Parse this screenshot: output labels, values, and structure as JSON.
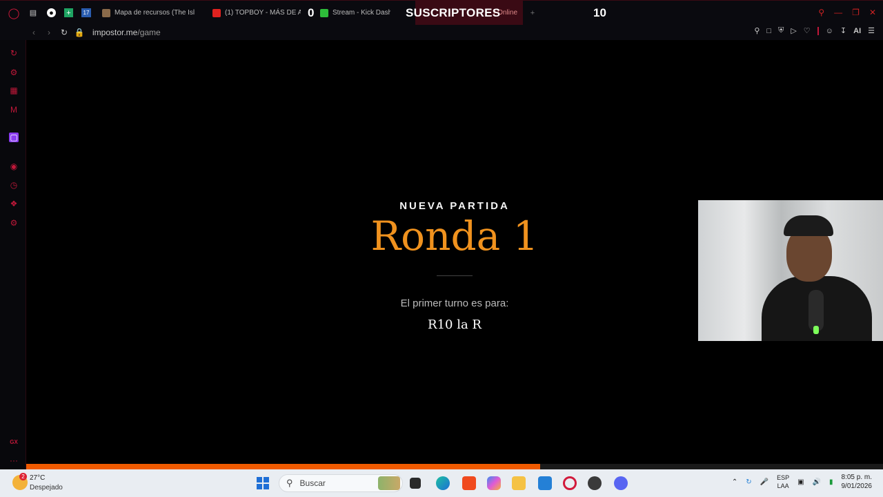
{
  "browser": {
    "tabs": [
      {
        "label": "Mapa de recursos (The Isl",
        "icon": "map-favicon"
      },
      {
        "label": "(1) TOPBOY - MÁS DE A",
        "icon": "youtube-favicon"
      },
      {
        "label": "Stream - Kick Dashb",
        "icon": "kick-favicon"
      },
      {
        "label": "r Online",
        "icon": "impostor-favicon"
      }
    ],
    "url_host": "impostor.me",
    "url_path": "/game",
    "ai_label": "AI"
  },
  "stream_overlay": {
    "left_count": "0",
    "title": "SUSCRIPTORES",
    "right_count": "10"
  },
  "game": {
    "kicker": "NUEVA PARTIDA",
    "round_title": "Ronda 1",
    "turn_label": "El primer turno es para:",
    "player_name": "R10 la R",
    "accent_color": "#f0921e",
    "turn_progress": 0.6
  },
  "sidebar": {
    "gx_label": "GX",
    "more_label": "···"
  },
  "taskbar": {
    "weather_temp": "27°C",
    "weather_desc": "Despejado",
    "weather_badge": "2",
    "search_placeholder": "Buscar",
    "lang_line1": "ESP",
    "lang_line2": "LAA",
    "time": "8:05 p. m.",
    "date": "9/01/2026"
  }
}
